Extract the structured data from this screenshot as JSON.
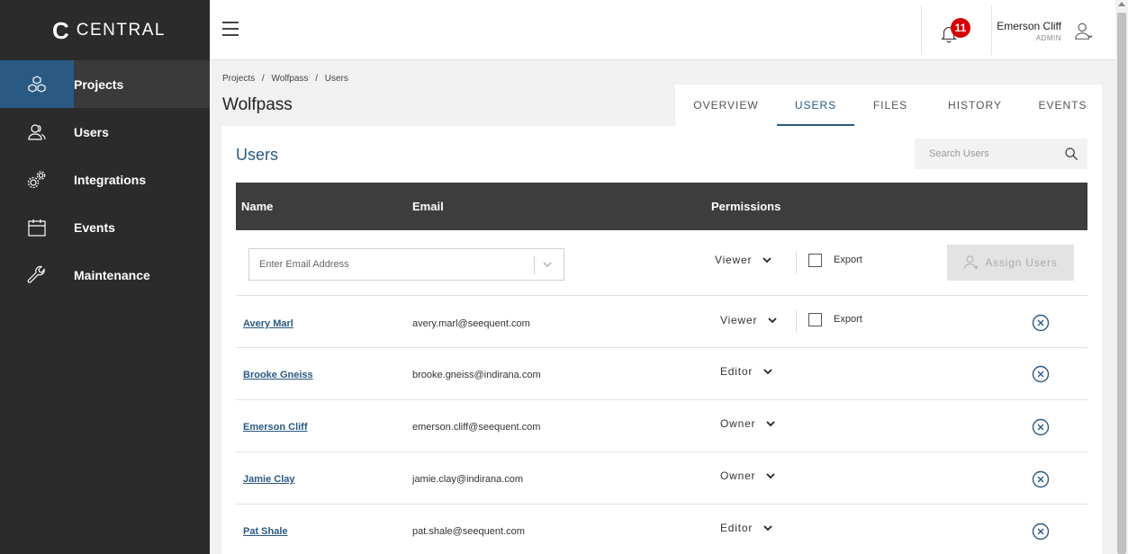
{
  "brand": {
    "logo_mark": "C",
    "logo_text": "CENTRAL"
  },
  "sidebar": {
    "items": [
      {
        "label": "Projects",
        "icon": "cubes-icon",
        "active": true
      },
      {
        "label": "Users",
        "icon": "users-icon"
      },
      {
        "label": "Integrations",
        "icon": "gears-icon"
      },
      {
        "label": "Events",
        "icon": "calendar-icon"
      },
      {
        "label": "Maintenance",
        "icon": "wrench-icon"
      }
    ]
  },
  "topbar": {
    "notifications_count": "11",
    "user_name": "Emerson Cliff",
    "user_role": "ADMIN"
  },
  "breadcrumb": {
    "parts": [
      "Projects",
      "Wolfpass",
      "Users"
    ],
    "separator": "/"
  },
  "page_title": "Wolfpass",
  "tabs": [
    {
      "label": "OVERVIEW"
    },
    {
      "label": "USERS",
      "active": true
    },
    {
      "label": "FILES"
    },
    {
      "label": "HISTORY"
    },
    {
      "label": "EVENTS"
    }
  ],
  "card": {
    "title": "Users",
    "search_placeholder": "Search Users"
  },
  "table": {
    "headers": {
      "name": "Name",
      "email": "Email",
      "permissions": "Permissions"
    },
    "add_row": {
      "email_placeholder": "Enter Email Address",
      "permission": "Viewer",
      "export_label": "Export",
      "assign_label": "Assign Users"
    },
    "rows": [
      {
        "name": "Avery Marl",
        "email": "avery.marl@seequent.com",
        "permission": "Viewer",
        "export_label": "Export"
      },
      {
        "name": "Brooke Gneiss",
        "email": "brooke.gneiss@indirana.com",
        "permission": "Editor"
      },
      {
        "name": "Emerson Cliff",
        "email": "emerson.cliff@seequent.com",
        "permission": "Owner"
      },
      {
        "name": "Jamie Clay",
        "email": "jamie.clay@indirana.com",
        "permission": "Owner"
      },
      {
        "name": "Pat Shale",
        "email": "pat.shale@seequent.com",
        "permission": "Editor"
      }
    ]
  },
  "colors": {
    "accent": "#2a5a84",
    "sidebar_bg": "#2b2b2b",
    "header_bg": "#3d3d3d",
    "badge": "#d60000"
  }
}
